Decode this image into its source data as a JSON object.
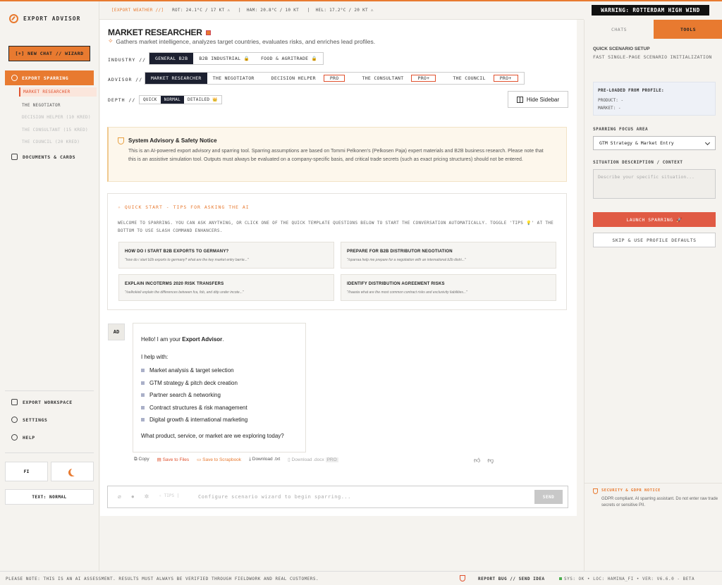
{
  "app": {
    "name": "EXPORT ADVISOR",
    "new_chat": "[+] NEW CHAT // WIZARD"
  },
  "sidebar": {
    "main_nav": "EXPORT SPARRING",
    "sub_items": [
      {
        "label": "MARKET RESEARCHER",
        "state": "active"
      },
      {
        "label": "THE NEGOTIATOR",
        "state": "normal"
      },
      {
        "label": "DECISION HELPER (10 KRED)",
        "state": "dim"
      },
      {
        "label": "THE CONSULTANT (15 KRED)",
        "state": "dim"
      },
      {
        "label": "THE COUNCIL (20 KRED)",
        "state": "dim"
      }
    ],
    "documents": "DOCUMENTS & CARDS",
    "workspace": "EXPORT WORKSPACE",
    "settings": "SETTINGS",
    "help": "HELP",
    "lang": "FI",
    "text_size": "TEXT: NORMAL"
  },
  "topbar": {
    "weather_label": "[EXPORT WEATHER //]",
    "weather_rot": "ROT: 24.1°C / 17 KT ⚠",
    "weather_ham": "HAM: 20.8°C / 10 KT",
    "weather_hel": "HEL: 17.2°C / 20 KT ⚠",
    "warning": "WARNING: ROTTERDAM HIGH WIND"
  },
  "main": {
    "title": "MARKET RESEARCHER",
    "subtitle": "Gathers market intelligence, analyzes target countries, evaluates risks, and enriches lead profiles.",
    "industry_label": "INDUSTRY //",
    "industries": [
      "GENERAL B2B",
      "B2B INDUSTRIAL 🔒",
      "FOOD & AGRITRADE 🔒"
    ],
    "advisor_label": "ADVISOR //",
    "advisors": [
      "MARKET RESEARCHER",
      "THE NEGOTIATOR",
      "DECISION HELPER",
      "THE CONSULTANT",
      "THE COUNCIL"
    ],
    "advisor_badges": [
      "PRO",
      "PRO+",
      "PRO+"
    ],
    "depth_label": "DEPTH //",
    "depths": [
      "QUICK",
      "NORMAL",
      "DETAILED 👑"
    ],
    "hide_sidebar": "Hide Sidebar",
    "notice_title": "System Advisory & Safety Notice",
    "notice_body": "This is an AI-powered export advisory and sparring tool. Sparring assumptions are based on Tommi Pelkonen's (Pelkosen Paja) expert materials and B2B business research. Please note that this is an assistive simulation tool. Outputs must always be evaluated on a company-specific basis, and critical trade secrets (such as exact pricing structures) should not be entered.",
    "qs_title": "QUICK START - TIPS FOR ASKING THE AI",
    "qs_desc": "WELCOME TO SPARRING. YOU CAN ASK ANYTHING, OR CLICK ONE OF THE QUICK TEMPLATE QUESTIONS BELOW TO START THE CONVERSATION AUTOMATICALLY. TOGGLE 'TIPS 💡' AT THE BOTTOM TO USE SLASH COMMAND ENHANCERS.",
    "cards": [
      {
        "title": "HOW DO I START B2B EXPORTS TO GERMANY?",
        "desc": "\"how do i start b2b exports to germany? what are the key market entry barrie...\""
      },
      {
        "title": "PREPARE FOR B2B DISTRIBUTOR NEGOTIATION",
        "desc": "\"/sparraa help me prepare for a negotiation with an international b2b distri...\""
      },
      {
        "title": "EXPLAIN INCOTERMS 2020 RISK TRANSFERS",
        "desc": "\"/selkokieli explain the differences between fca, fob, and ddp under incote...\""
      },
      {
        "title": "IDENTIFY DISTRIBUTION AGREEMENT RISKS",
        "desc": "\"/haasta what are the most common contract risks and exclusivity liabilities...\""
      }
    ],
    "avatar": "AD",
    "msg_hello": "Hello! I am your ",
    "msg_name": "Export Advisor",
    "msg_dot": ".",
    "msg_help": "I help with:",
    "msg_items": [
      "Market analysis & target selection",
      "GTM strategy & pitch deck creation",
      "Partner search & networking",
      "Contract structures & risk management",
      "Digital growth & international marketing"
    ],
    "msg_question": "What product, service, or market are we exploring today?",
    "actions": [
      "Copy",
      "Save to Files",
      "Save to Scrapbook",
      "Download .txt",
      "Download .docx",
      "PRO"
    ],
    "input_tips": "TIPS",
    "input_placeholder": "Configure scenario wizard to begin sparring...",
    "send": "SEND"
  },
  "right": {
    "tabs": [
      "CHATS",
      "TOOLS"
    ],
    "qs_title": "QUICK SCENARIO SETUP",
    "qs_desc": "FAST SINGLE-PAGE SCENARIO INITIALIZATION",
    "preload_title": "PRE-LOADED FROM PROFILE:",
    "product": "PRODUCT: -",
    "market": "MARKET: -",
    "focus_label": "SPARRING FOCUS AREA",
    "focus_value": "GTM Strategy & Market Entry",
    "situation_label": "SITUATION DESCRIPTION / CONTEXT",
    "situation_placeholder": "Describe your specific situation...",
    "launch": "LAUNCH SPARRING 🚀",
    "skip": "SKIP & USE PROFILE DEFAULTS",
    "gdpr_title": "SECURITY & GDPR NOTICE",
    "gdpr_desc": "GDPR compliant. AI sparring assistant. Do not enter raw trade secrets or sensitive PII."
  },
  "footer": {
    "note": "PLEASE NOTE: THIS IS AN AI ASSESSMENT. RESULTS MUST ALWAYS BE VERIFIED THROUGH FIELDWORK AND REAL CUSTOMERS.",
    "bug": "REPORT BUG // SEND IDEA",
    "status": "SYS: OK  •  LOC: HAMINA_FI  •  VER: V6.6.0 - BETA"
  },
  "colors": {
    "accent": "#e87a30",
    "dark": "#1c2030",
    "danger": "#e05a44"
  }
}
